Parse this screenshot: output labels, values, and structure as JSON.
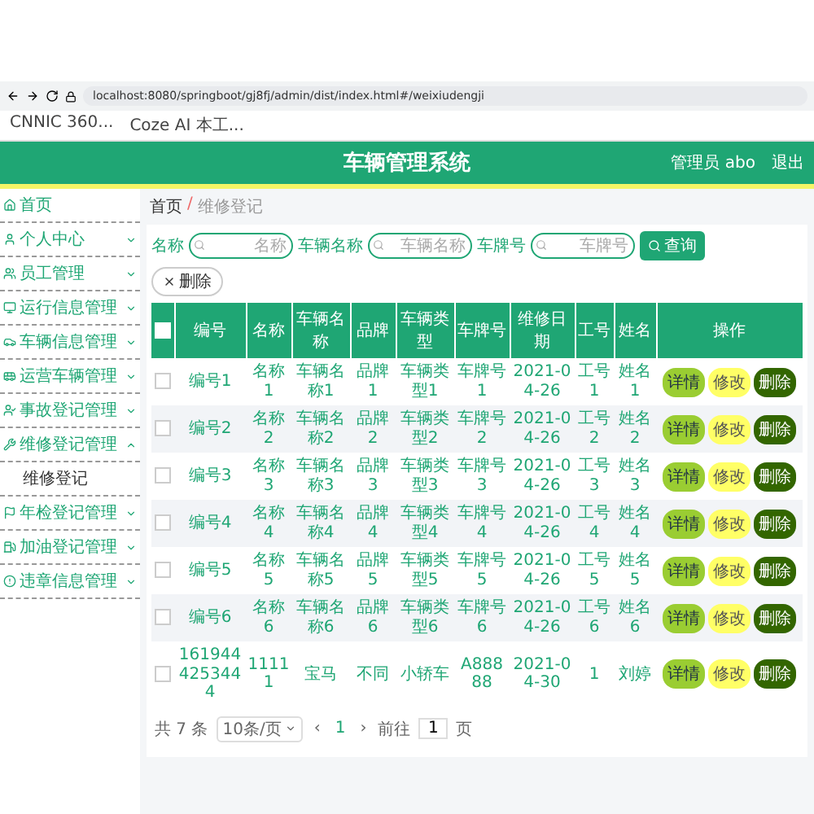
{
  "browser": {
    "url": "localhost:8080/springboot/gj8fj/admin/dist/index.html#/weixiudengji",
    "bookmarks": [
      "CNNIC 360...",
      "Coze AI 本工..."
    ]
  },
  "header": {
    "title": "车辆管理系统",
    "user": "管理员 abo",
    "logout": "退出"
  },
  "sidebar": {
    "items": [
      {
        "label": "首页"
      },
      {
        "label": "个人中心",
        "expanded": false
      },
      {
        "label": "员工管理",
        "expanded": false
      },
      {
        "label": "运行信息管理",
        "expanded": false
      },
      {
        "label": "车辆信息管理",
        "expanded": false
      },
      {
        "label": "运营车辆管理",
        "expanded": false
      },
      {
        "label": "事故登记管理",
        "expanded": false
      },
      {
        "label": "维修登记管理",
        "expanded": true,
        "children": [
          {
            "label": "维修登记"
          }
        ]
      },
      {
        "label": "年检登记管理",
        "expanded": false
      },
      {
        "label": "加油登记管理",
        "expanded": false
      },
      {
        "label": "违章信息管理",
        "expanded": false
      }
    ]
  },
  "breadcrumb": {
    "separator": "/",
    "items": [
      "首页",
      "维修登记"
    ]
  },
  "search": {
    "fields": [
      {
        "label": "名称",
        "placeholder": "名称"
      },
      {
        "label": "车辆名称",
        "placeholder": "车辆名称"
      },
      {
        "label": "车牌号",
        "placeholder": "车牌号"
      }
    ],
    "button": "查询"
  },
  "delete_button": "删除",
  "table": {
    "select_all_checked": false,
    "columns": [
      "编号",
      "名称",
      "车辆名称",
      "品牌",
      "车辆类型",
      "车牌号",
      "维修日期",
      "工号",
      "姓名",
      "操作"
    ],
    "rows": [
      {
        "checked": false,
        "cells": [
          "编号1",
          "名称1",
          "车辆名称1",
          "品牌1",
          "车辆类型1",
          "车牌号1",
          "2021-04-26",
          "工号1",
          "姓名1"
        ],
        "actions": [
          {
            "kind": "detail",
            "label": "详情"
          },
          {
            "kind": "edit",
            "label": "修改"
          },
          {
            "kind": "delete",
            "label": "删除"
          }
        ]
      },
      {
        "checked": false,
        "cells": [
          "编号2",
          "名称2",
          "车辆名称2",
          "品牌2",
          "车辆类型2",
          "车牌号2",
          "2021-04-26",
          "工号2",
          "姓名2"
        ],
        "actions": [
          {
            "kind": "detail",
            "label": "详情"
          },
          {
            "kind": "edit",
            "label": "修改"
          },
          {
            "kind": "delete",
            "label": "删除"
          }
        ]
      },
      {
        "checked": false,
        "cells": [
          "编号3",
          "名称3",
          "车辆名称3",
          "品牌3",
          "车辆类型3",
          "车牌号3",
          "2021-04-26",
          "工号3",
          "姓名3"
        ],
        "actions": [
          {
            "kind": "detail",
            "label": "详情"
          },
          {
            "kind": "edit",
            "label": "修改"
          },
          {
            "kind": "delete",
            "label": "删除"
          }
        ]
      },
      {
        "checked": false,
        "cells": [
          "编号4",
          "名称4",
          "车辆名称4",
          "品牌4",
          "车辆类型4",
          "车牌号4",
          "2021-04-26",
          "工号4",
          "姓名4"
        ],
        "actions": [
          {
            "kind": "detail",
            "label": "详情"
          },
          {
            "kind": "edit",
            "label": "修改"
          },
          {
            "kind": "delete",
            "label": "删除"
          }
        ]
      },
      {
        "checked": false,
        "cells": [
          "编号5",
          "名称5",
          "车辆名称5",
          "品牌5",
          "车辆类型5",
          "车牌号5",
          "2021-04-26",
          "工号5",
          "姓名5"
        ],
        "actions": [
          {
            "kind": "detail",
            "label": "详情"
          },
          {
            "kind": "edit",
            "label": "修改"
          },
          {
            "kind": "delete",
            "label": "删除"
          }
        ]
      },
      {
        "checked": false,
        "cells": [
          "编号6",
          "名称6",
          "车辆名称6",
          "品牌6",
          "车辆类型6",
          "车牌号6",
          "2021-04-26",
          "工号6",
          "姓名6"
        ],
        "actions": [
          {
            "kind": "detail",
            "label": "详情"
          },
          {
            "kind": "edit",
            "label": "修改"
          },
          {
            "kind": "delete",
            "label": "删除"
          }
        ]
      },
      {
        "checked": false,
        "cells": [
          "1619444253444",
          "11111",
          "宝马",
          "不同",
          "小轿车",
          "A88888",
          "2021-04-30",
          "1",
          "刘婷"
        ],
        "actions": [
          {
            "kind": "detail",
            "label": "详情"
          },
          {
            "kind": "edit",
            "label": "修改"
          },
          {
            "kind": "delete",
            "label": "删除"
          }
        ]
      }
    ]
  },
  "pagination": {
    "total": "共 7 条",
    "page_size": "10条/页",
    "prev": "‹",
    "page": "1",
    "next": "›",
    "goto": "前往",
    "goto_value": "1",
    "goto_suffix": "页"
  }
}
